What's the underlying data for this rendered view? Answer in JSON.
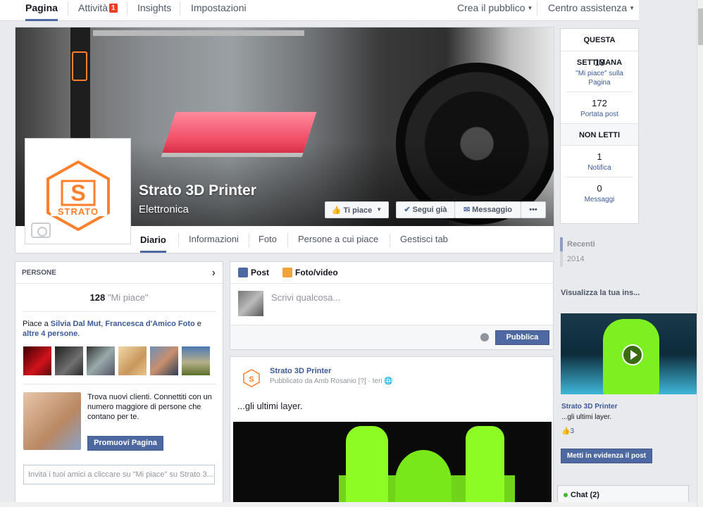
{
  "admin_tabs": [
    {
      "label": "Pagina"
    },
    {
      "label": "Attività",
      "badge": "1"
    },
    {
      "label": "Insights"
    },
    {
      "label": "Impostazioni"
    }
  ],
  "admin_right": {
    "create_audience": "Crea il pubblico",
    "help_center": "Centro assistenza"
  },
  "page": {
    "name": "Strato 3D Printer",
    "category": "Elettronica",
    "logo_text": "STRATO",
    "logo_letter": "S"
  },
  "cover_buttons": {
    "like": "Ti piace",
    "follow": "Segui già",
    "message": "Messaggio",
    "more": "•••"
  },
  "page_tabs": [
    "Diario",
    "Informazioni",
    "Foto",
    "Persone a cui piace",
    "Gestisci tab"
  ],
  "stats": {
    "week_title": "QUESTA SETTIMANA",
    "likes_num": "13",
    "likes_label": "\"Mi piace\" sulla Pagina",
    "reach_num": "172",
    "reach_label": "Portata post",
    "unread_title": "NON LETTI",
    "notif_num": "1",
    "notif_label": "Notifica",
    "msg_num": "0",
    "msg_label": "Messaggi"
  },
  "timeline_nav": {
    "recent": "Recenti",
    "year": "2014"
  },
  "insights_link": "Visualizza la tua ins...",
  "video_post": {
    "title": "Strato 3D Printer",
    "text": "...gli ultimi layer.",
    "likes": "3",
    "boost_button": "Metti in evidenza il post"
  },
  "chat": {
    "label": "Chat (2)"
  },
  "people": {
    "header": "PERSONE",
    "likes_count": "128",
    "likes_word": "\"Mi piace\"",
    "friends_prefix": "Piace a ",
    "friend1": "Silvia Dal Mut",
    "sep": ", ",
    "friend2": "Francesca d'Amico Foto",
    "and": " e ",
    "others": "altre 4 persone",
    "end": "."
  },
  "promo": {
    "text": "Trova nuovi clienti. Connettiti con un numero maggiore di persone che contano per te.",
    "button": "Promuovi Pagina"
  },
  "invite": {
    "placeholder": "Invita i tuoi amici a cliccare su \"Mi piace\" su Strato 3..."
  },
  "composer": {
    "tab_post": "Post",
    "tab_photo": "Foto/video",
    "placeholder": "Scrivi qualcosa...",
    "publish": "Pubblica"
  },
  "post": {
    "author": "Strato 3D Printer",
    "meta_by": "Pubblicato da Amb Rosanio",
    "meta_q": "[?]",
    "meta_time": "Ieri",
    "text": "...gli ultimi layer."
  },
  "colors": {
    "brand_blue": "#3b5998",
    "button_blue": "#4e69a2",
    "strato_orange": "#ff7f2a",
    "badge_red": "#f03d25"
  }
}
